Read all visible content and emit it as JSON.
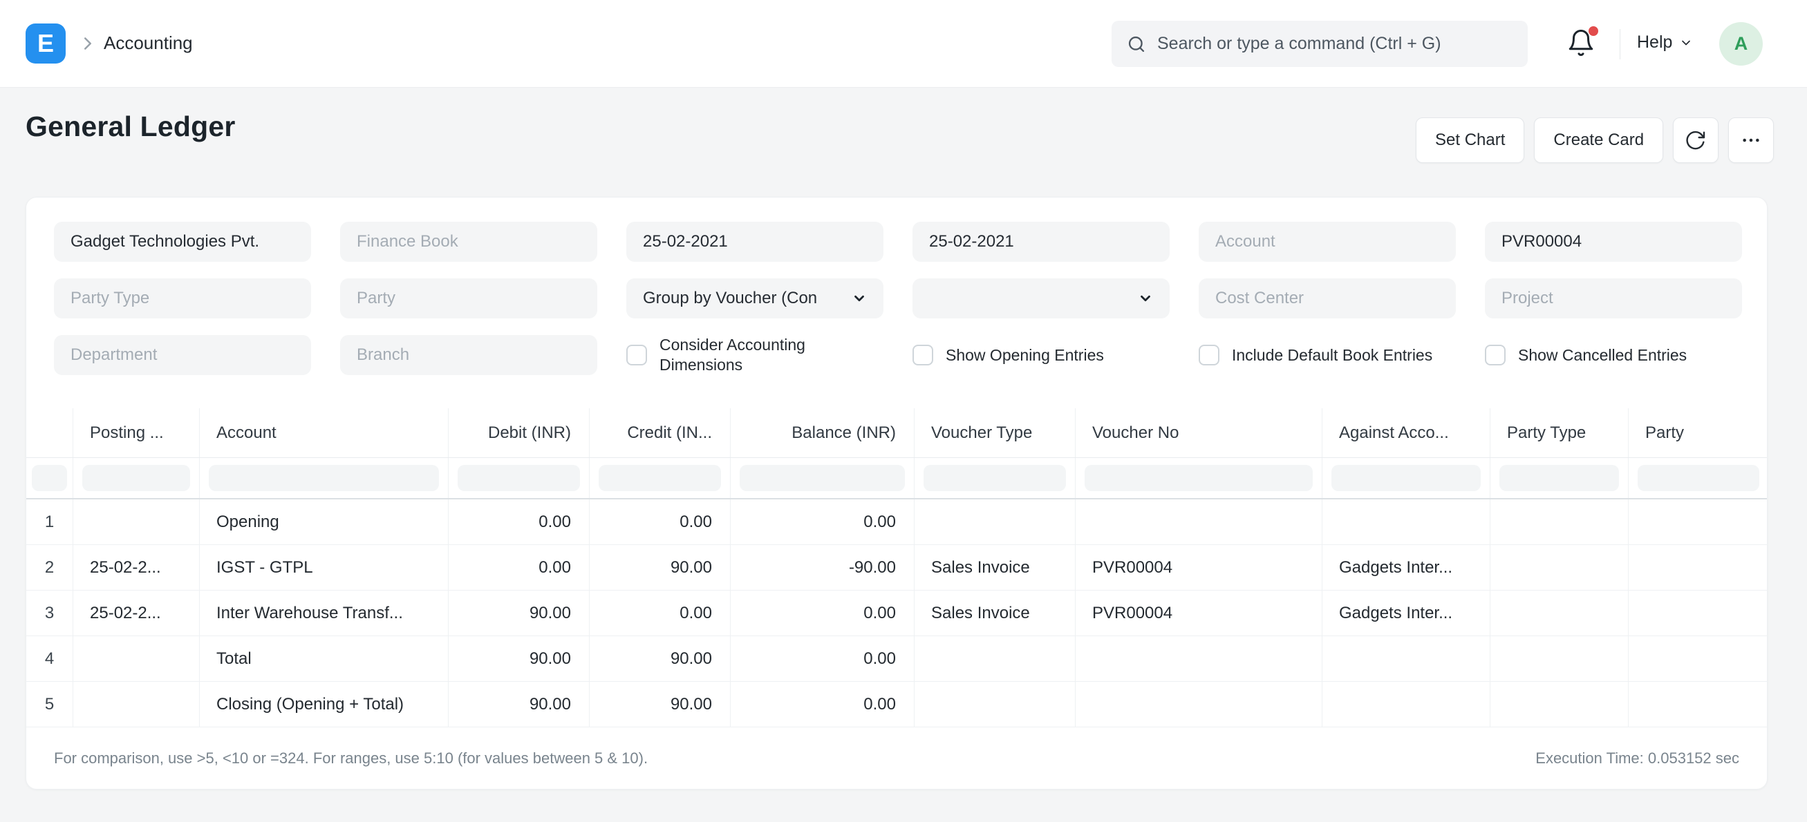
{
  "colors": {
    "accent_blue": "#2490ef",
    "notification_red": "#e24c4c",
    "avatar_bg": "#ddf0e3",
    "avatar_text": "#2f9e5b"
  },
  "navbar": {
    "logo_letter": "E",
    "breadcrumb": "Accounting",
    "search_placeholder": "Search or type a command (Ctrl + G)",
    "help_label": "Help",
    "avatar_letter": "A"
  },
  "page": {
    "title": "General Ledger",
    "set_chart_label": "Set Chart",
    "create_card_label": "Create Card"
  },
  "filters": {
    "company": {
      "value": "Gadget Technologies Pvt."
    },
    "finance_book": {
      "placeholder": "Finance Book"
    },
    "from_date": {
      "value": "25-02-2021"
    },
    "to_date": {
      "value": "25-02-2021"
    },
    "account": {
      "placeholder": "Account"
    },
    "voucher_no": {
      "value": "PVR00004"
    },
    "party_type": {
      "placeholder": "Party Type"
    },
    "party": {
      "placeholder": "Party"
    },
    "group_by": {
      "value": "Group by Voucher (Con"
    },
    "secondary_select": {
      "value": ""
    },
    "cost_center": {
      "placeholder": "Cost Center"
    },
    "project": {
      "placeholder": "Project"
    },
    "department": {
      "placeholder": "Department"
    },
    "branch": {
      "placeholder": "Branch"
    },
    "checkboxes": [
      {
        "label": "Consider Accounting Dimensions",
        "checked": false
      },
      {
        "label": "Show Opening Entries",
        "checked": false
      },
      {
        "label": "Include Default Book Entries",
        "checked": false
      },
      {
        "label": "Show Cancelled Entries",
        "checked": false
      }
    ]
  },
  "table": {
    "headers": [
      "",
      "Posting ...",
      "Account",
      "Debit (INR)",
      "Credit (IN...",
      "Balance (INR)",
      "Voucher Type",
      "Voucher No",
      "Against Acco...",
      "Party Type",
      "Party"
    ],
    "rows": [
      [
        "1",
        "",
        "Opening",
        "0.00",
        "0.00",
        "0.00",
        "",
        "",
        "",
        "",
        ""
      ],
      [
        "2",
        "25-02-2...",
        "IGST - GTPL",
        "0.00",
        "90.00",
        "-90.00",
        "Sales Invoice",
        "PVR00004",
        "Gadgets Inter...",
        "",
        ""
      ],
      [
        "3",
        "25-02-2...",
        "Inter Warehouse Transf...",
        "90.00",
        "0.00",
        "0.00",
        "Sales Invoice",
        "PVR00004",
        "Gadgets Inter...",
        "",
        ""
      ],
      [
        "4",
        "",
        "Total",
        "90.00",
        "90.00",
        "0.00",
        "",
        "",
        "",
        "",
        ""
      ],
      [
        "5",
        "",
        "Closing (Opening + Total)",
        "90.00",
        "90.00",
        "0.00",
        "",
        "",
        "",
        "",
        ""
      ]
    ]
  },
  "footer": {
    "hint": "For comparison, use >5, <10 or =324. For ranges, use 5:10 (for values between 5 & 10).",
    "execution_time": "Execution Time: 0.053152 sec"
  }
}
